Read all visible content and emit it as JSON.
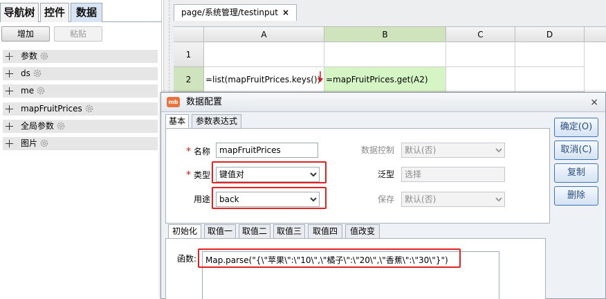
{
  "left_panel": {
    "tabs": [
      "导航树",
      "控件",
      "数据"
    ],
    "buttons": {
      "add": "增加",
      "paste": "粘贴"
    },
    "tree_items": [
      "参数",
      "ds",
      "me",
      "mapFruitPrices",
      "全局参数",
      "图片"
    ]
  },
  "editor": {
    "tab_label": "page/系统管理/testinput",
    "tab_close": "×",
    "columns": [
      "A",
      "B",
      "C",
      "D"
    ],
    "rows": [
      {
        "num": "1",
        "a": "",
        "b": ""
      },
      {
        "num": "2",
        "a": "=list(mapFruitPrices.keys())",
        "b": "=mapFruitPrices.get(A2)"
      }
    ]
  },
  "dialog": {
    "logo": "mb",
    "title": "数据配置",
    "close": "×",
    "tabs": [
      "基本",
      "参数表达式"
    ],
    "fields": {
      "name_label": "名称",
      "name_value": "mapFruitPrices",
      "type_label": "类型",
      "type_value": "键值对",
      "usage_label": "用途",
      "usage_value": "back",
      "data_control_label": "数据控制",
      "data_control_value": "默认(否)",
      "generic_label": "泛型",
      "generic_value": "选择",
      "save_label": "保存",
      "save_value": "默认(否)"
    },
    "buttons": {
      "ok": "确定(O)",
      "cancel": "取消(C)",
      "copy": "复制",
      "delete": "删除"
    },
    "sub_tabs": [
      "初始化",
      "取值一",
      "取值二",
      "取值三",
      "取值四",
      "值改变"
    ],
    "function_label": "函数:",
    "function_value": "Map.parse(\"{\\\"苹果\\\":\\\"10\\\",\\\"橘子\\\":\\\"20\\\",\\\"香蕉\\\":\\\"30\\\"}\")"
  },
  "colors": {
    "selected_col": "#cfe3bd",
    "formula_cell": "#d6f5c5",
    "highlight_box": "#e32020",
    "button_text": "#2a4e84"
  }
}
